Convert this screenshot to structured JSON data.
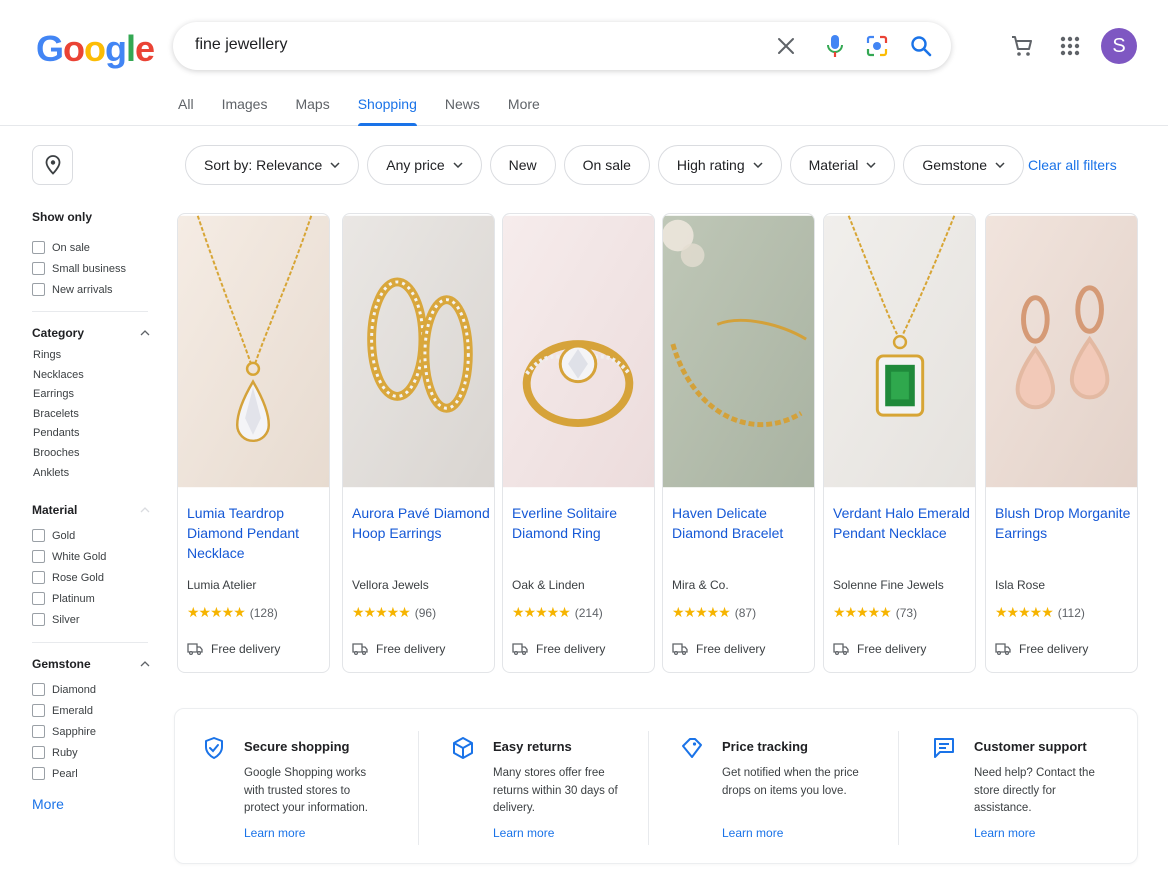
{
  "header": {
    "logo_letters": [
      "G",
      "o",
      "o",
      "g",
      "l",
      "e"
    ],
    "logo_colors": [
      "#4285F4",
      "#EA4335",
      "#FBBC05",
      "#4285F4",
      "#34A853",
      "#EA4335"
    ],
    "search_query": "fine jewellery",
    "avatar_letter": "S",
    "avatar_color": "#7e57c2"
  },
  "tabs": [
    {
      "label": "All",
      "active": false
    },
    {
      "label": "Images",
      "active": false
    },
    {
      "label": "Maps",
      "active": false
    },
    {
      "label": "Shopping",
      "active": true
    },
    {
      "label": "News",
      "active": false
    },
    {
      "label": "More",
      "active": false
    }
  ],
  "filters": {
    "chips": [
      {
        "label": "Sort by: Relevance",
        "dropdown": true
      },
      {
        "label": "Any price",
        "dropdown": true
      },
      {
        "label": "New",
        "dropdown": false
      },
      {
        "label": "On sale",
        "dropdown": false
      },
      {
        "label": "High rating",
        "dropdown": true
      },
      {
        "label": "Material",
        "dropdown": true
      },
      {
        "label": "Gemstone",
        "dropdown": true
      }
    ],
    "clear_label": "Clear all filters"
  },
  "sidebar": {
    "show_only": {
      "title": "Show only",
      "options": [
        "On sale",
        "Small business",
        "New arrivals"
      ]
    },
    "category": {
      "title": "Category",
      "options": [
        "Rings",
        "Necklaces",
        "Earrings",
        "Bracelets",
        "Pendants",
        "Brooches",
        "Anklets"
      ]
    },
    "material": {
      "title": "Material",
      "options": [
        "Gold",
        "White Gold",
        "Rose Gold",
        "Platinum",
        "Silver"
      ]
    },
    "gemstone": {
      "title": "Gemstone",
      "options": [
        "Diamond",
        "Emerald",
        "Sapphire",
        "Ruby",
        "Pearl"
      ]
    },
    "more_label": "More"
  },
  "products": [
    {
      "title": "Lumia Teardrop Diamond Pendant Necklace",
      "seller": "Lumia Atelier",
      "rating": 4.5,
      "reviews": "(128)",
      "delivery": "Free delivery"
    },
    {
      "title": "Aurora Pavé Diamond Hoop Earrings",
      "seller": "Vellora Jewels",
      "rating": 4.5,
      "reviews": "(96)",
      "delivery": "Free delivery"
    },
    {
      "title": "Everline Solitaire Diamond Ring",
      "seller": "Oak & Linden",
      "rating": 4.5,
      "reviews": "(214)",
      "delivery": "Free delivery"
    },
    {
      "title": "Haven Delicate Diamond Bracelet",
      "seller": "Mira & Co.",
      "rating": 4.5,
      "reviews": "(87)",
      "delivery": "Free delivery"
    },
    {
      "title": "Verdant Halo Emerald Pendant Necklace",
      "seller": "Solenne Fine Jewels",
      "rating": 4.5,
      "reviews": "(73)",
      "delivery": "Free delivery"
    },
    {
      "title": "Blush Drop Morganite Earrings",
      "seller": "Isla Rose",
      "rating": 4.5,
      "reviews": "(112)",
      "delivery": "Free delivery"
    }
  ],
  "info": [
    {
      "icon": "shield-check-icon",
      "title": "Secure shopping",
      "desc": "Google Shopping works with trusted stores to protect your information.",
      "link": "Learn more"
    },
    {
      "icon": "box-icon",
      "title": "Easy returns",
      "desc": "Many stores offer free returns within 30 days of delivery.",
      "link": "Learn more"
    },
    {
      "icon": "price-tag-icon",
      "title": "Price tracking",
      "desc": "Get notified when the price drops on items you love.",
      "link": "Learn more"
    },
    {
      "icon": "chat-icon",
      "title": "Customer support",
      "desc": "Need help? Contact the store directly for assistance.",
      "link": "Learn more"
    }
  ],
  "colors": {
    "accent": "#1a73e8",
    "star": "#f6b400"
  }
}
